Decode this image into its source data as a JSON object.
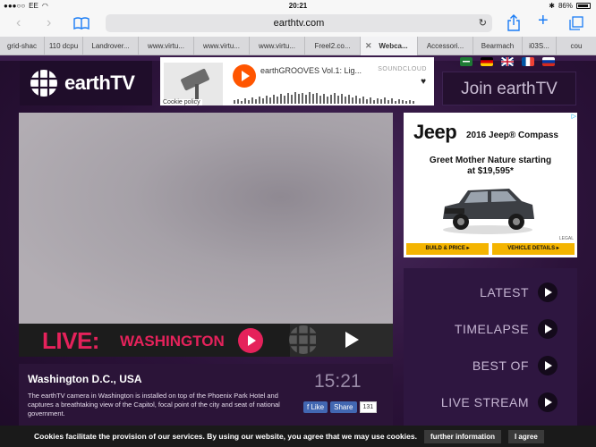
{
  "status_bar": {
    "carrier": "EE",
    "time": "20:21",
    "battery": "86%"
  },
  "browser": {
    "url": "earthtv.com",
    "tabs": [
      {
        "label": "grid-shac"
      },
      {
        "label": "110 dcpu"
      },
      {
        "label": "Landrover..."
      },
      {
        "label": "www.virtu..."
      },
      {
        "label": "www.virtu..."
      },
      {
        "label": "www.virtu..."
      },
      {
        "label": "Freel2.co..."
      },
      {
        "label": "Webca...",
        "active": true
      },
      {
        "label": "Accessori..."
      },
      {
        "label": "Bearmach"
      },
      {
        "label": "i03S..."
      },
      {
        "label": "cou"
      }
    ]
  },
  "header": {
    "logo_text": "earthTV",
    "soundcloud": {
      "title": "earthGROOVES Vol.1: Lig...",
      "brand": "SOUNDCLOUD",
      "cookie_text": "Cookie policy"
    },
    "join_label": "Join earthTV"
  },
  "video": {
    "live_word": "LIVE:",
    "city": "WASHINGTON"
  },
  "info": {
    "title": "Washington D.C., USA",
    "description": "The earthTV camera in Washington is installed on top of the Phoenix Park Hotel and captures a breathtaking view of the Capitol, focal point of the city and seat of national government.",
    "local_time": "15:21",
    "like_label": "Like",
    "share_label": "Share",
    "share_count": "131"
  },
  "ad": {
    "brand": "Jeep",
    "model": "2016 Jeep® Compass",
    "headline_1": "Greet Mother Nature starting",
    "headline_2": "at $19,595*",
    "legal": "LEGAL",
    "cta_left": "BUILD & PRICE ▸",
    "cta_right": "VEHICLE DETAILS ▸"
  },
  "menu": {
    "items": [
      {
        "label": "LATEST"
      },
      {
        "label": "TIMELAPSE"
      },
      {
        "label": "BEST OF"
      },
      {
        "label": "LIVE STREAM"
      }
    ]
  },
  "cookie_bar": {
    "text": "Cookies facilitate the provision of our services. By using our website, you agree that we may use cookies.",
    "info_button": "further information",
    "agree_button": "I agree"
  },
  "colors": {
    "accent": "#e5225b",
    "background": "#2a1338",
    "soundcloud": "#ff5500"
  }
}
